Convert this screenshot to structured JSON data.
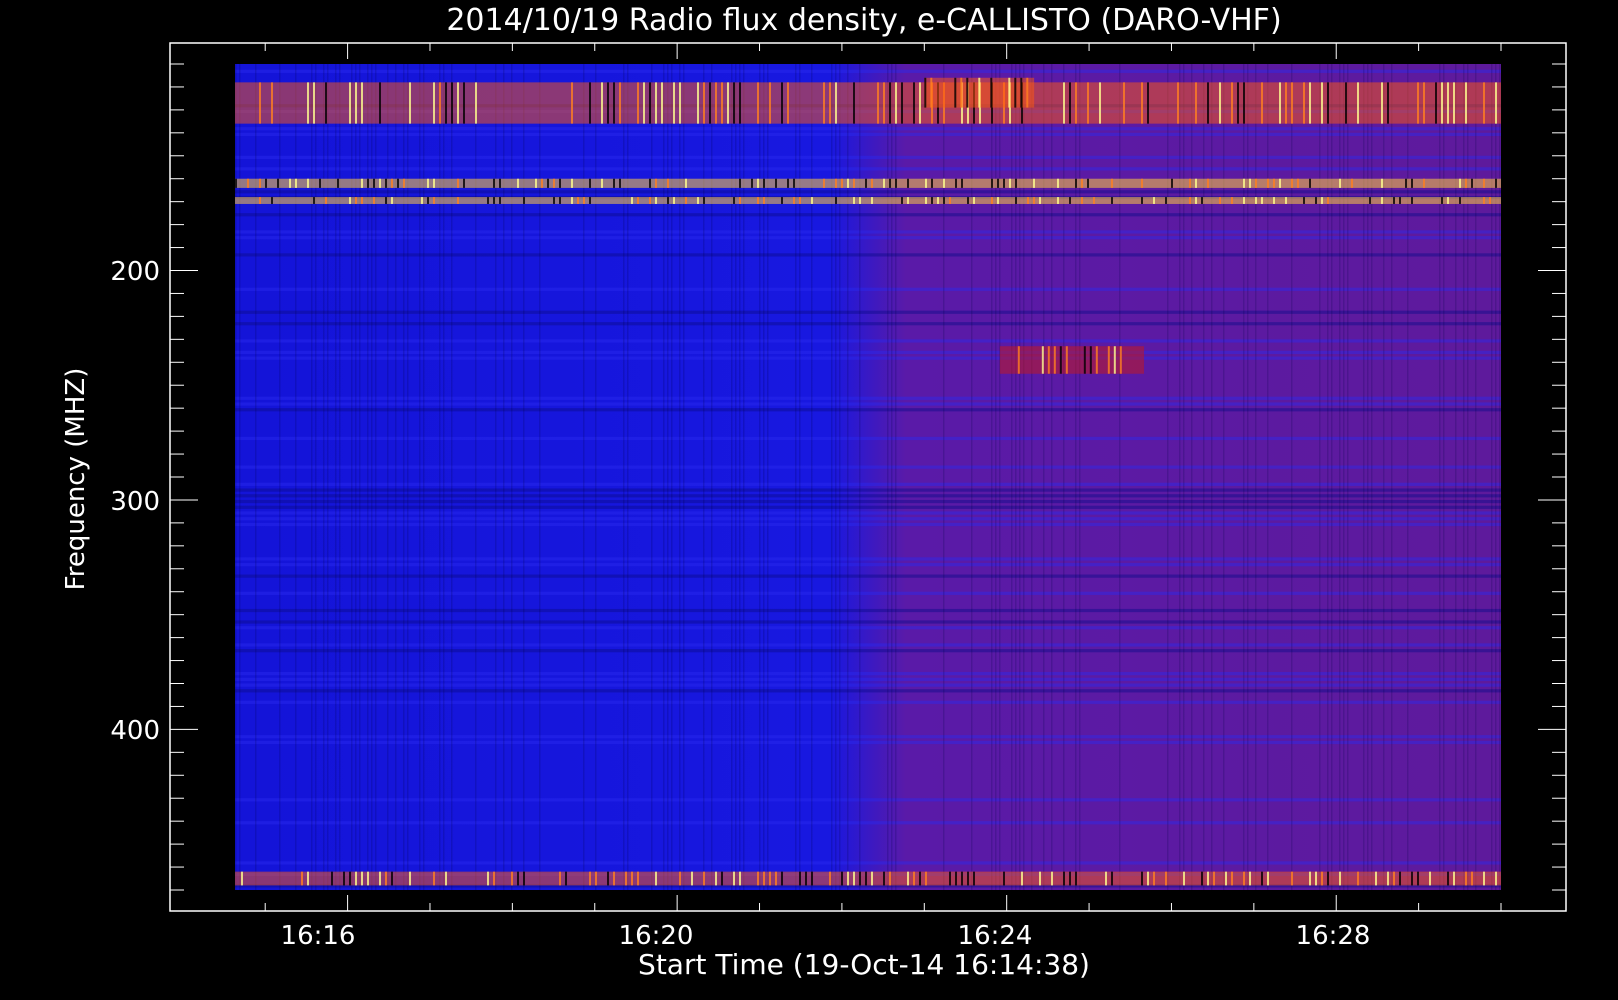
{
  "chart_data": {
    "type": "heatmap",
    "title": "2014/10/19  Radio flux density, e-CALLISTO (DARO-VHF)",
    "xlabel": "Start Time (19-Oct-14 16:14:38)",
    "ylabel": "Frequency (MHZ)",
    "x_ticks": [
      "16:16",
      "16:20",
      "16:24",
      "16:28"
    ],
    "y_ticks": [
      "200",
      "300",
      "400"
    ],
    "x_range": [
      "16:14:38",
      "16:30:00"
    ],
    "y_range": [
      110,
      470
    ],
    "y_reversed": true,
    "colormap": [
      "#000000",
      "#1010d0",
      "#3030ff",
      "#8a1030",
      "#c01818",
      "#ff4010",
      "#ffb000",
      "#ffff80"
    ],
    "background_level_before_16:22:50": "blue",
    "background_level_after_16:22:50": "red-purple",
    "features": [
      {
        "label": "interference band",
        "freq_mhz": [
          118,
          136
        ],
        "time": [
          "16:14:38",
          "16:30:00"
        ],
        "intensity": "high"
      },
      {
        "label": "strong line",
        "freq_mhz": [
          160,
          164
        ],
        "time": [
          "16:14:38",
          "16:30:00"
        ],
        "intensity": "very high"
      },
      {
        "label": "strong line",
        "freq_mhz": [
          168,
          171
        ],
        "time": [
          "16:14:38",
          "16:30:00"
        ],
        "intensity": "very high"
      },
      {
        "label": "burst",
        "freq_mhz": [
          116,
          129
        ],
        "time": [
          "16:23:00",
          "16:24:20"
        ],
        "intensity": "high"
      },
      {
        "label": "emission patch",
        "freq_mhz": [
          233,
          245
        ],
        "time": [
          "16:23:55",
          "16:25:40"
        ],
        "intensity": "medium-high"
      },
      {
        "label": "bottom edge band",
        "freq_mhz": [
          462,
          468
        ],
        "time": [
          "16:14:38",
          "16:30:00"
        ],
        "intensity": "high"
      }
    ]
  }
}
